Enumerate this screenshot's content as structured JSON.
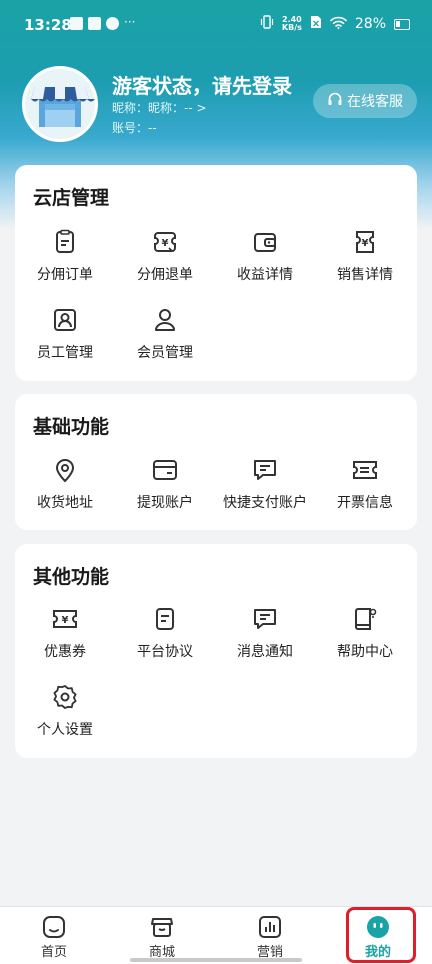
{
  "status_bar": {
    "time": "13:28",
    "net_speed_value": "2.40",
    "net_speed_unit": "KB/s",
    "battery": "28%"
  },
  "profile": {
    "title": "游客状态，请先登录",
    "nickname": "昵称：昵称：-- >",
    "account": "账号：--"
  },
  "service_button": {
    "label": "在线客服",
    "icon": "headset-icon"
  },
  "sections": {
    "cloud_store": {
      "title": "云店管理",
      "items": [
        {
          "label": "分佣订单",
          "icon": "order-doc-icon"
        },
        {
          "label": "分佣退单",
          "icon": "yuan-refund-icon"
        },
        {
          "label": "收益详情",
          "icon": "wallet-icon"
        },
        {
          "label": "销售详情",
          "icon": "yuan-ticket-icon"
        },
        {
          "label": "员工管理",
          "icon": "employee-badge-icon"
        },
        {
          "label": "会员管理",
          "icon": "member-person-icon"
        }
      ]
    },
    "basic": {
      "title": "基础功能",
      "items": [
        {
          "label": "收货地址",
          "icon": "location-pin-icon"
        },
        {
          "label": "提现账户",
          "icon": "card-icon"
        },
        {
          "label": "快捷支付账户",
          "icon": "chat-pay-icon"
        },
        {
          "label": "开票信息",
          "icon": "invoice-ticket-icon"
        }
      ]
    },
    "other": {
      "title": "其他功能",
      "items": [
        {
          "label": "优惠券",
          "icon": "coupon-icon"
        },
        {
          "label": "平台协议",
          "icon": "agreement-doc-icon"
        },
        {
          "label": "消息通知",
          "icon": "message-icon"
        },
        {
          "label": "帮助中心",
          "icon": "help-book-icon"
        },
        {
          "label": "个人设置",
          "icon": "gear-icon"
        }
      ]
    }
  },
  "tabbar": {
    "items": [
      {
        "label": "首页",
        "icon": "home-icon"
      },
      {
        "label": "商城",
        "icon": "store-icon"
      },
      {
        "label": "营销",
        "icon": "chart-icon"
      },
      {
        "label": "我的",
        "icon": "profile-face-icon"
      }
    ],
    "active_index": 3
  },
  "colors": {
    "accent": "#1aa3a6",
    "highlight_box": "#e01e2a",
    "icon_stroke": "#333333"
  }
}
